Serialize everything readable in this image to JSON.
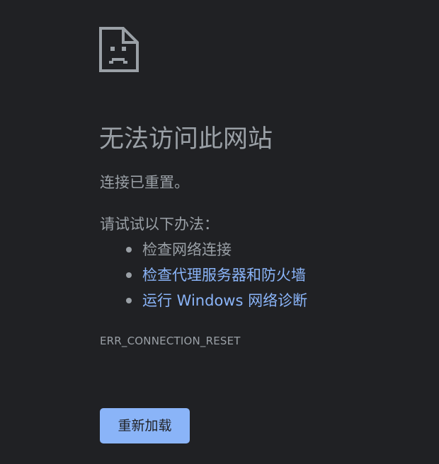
{
  "error": {
    "icon": "sad-document-icon",
    "title": "无法访问此网站",
    "summary": "连接已重置。",
    "suggestions_heading": "请试试以下办法：",
    "suggestions": [
      {
        "label": "检查网络连接",
        "link": false
      },
      {
        "label": "检查代理服务器和防火墙",
        "link": true
      },
      {
        "label": "运行 Windows 网络诊断",
        "link": true
      }
    ],
    "code": "ERR_CONNECTION_RESET"
  },
  "actions": {
    "reload_label": "重新加载"
  },
  "colors": {
    "background": "#202124",
    "text": "#9aa0a6",
    "link": "#8ab4f8",
    "button_bg": "#8ab4f8",
    "button_text": "#202124"
  }
}
